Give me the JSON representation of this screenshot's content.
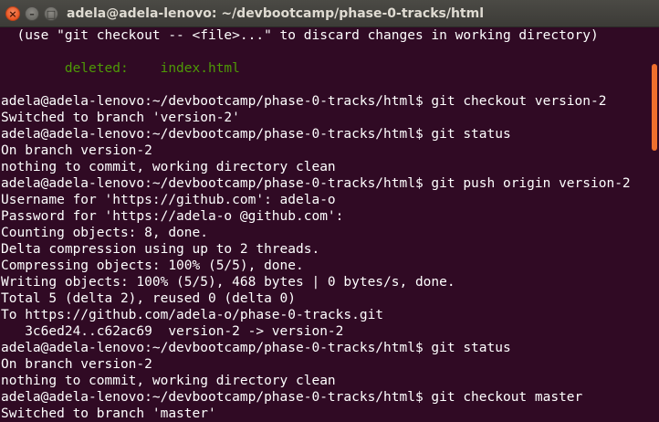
{
  "window": {
    "title": "adela@adela-lenovo: ~/devbootcamp/phase-0-tracks/html",
    "buttons": {
      "close": "×",
      "minimize": "–",
      "maximize": "□"
    }
  },
  "terminal": {
    "lines": [
      "  (use \"git checkout -- <file>...\" to discard changes in working directory)",
      "",
      "        deleted:    index.html",
      "",
      "adela@adela-lenovo:~/devbootcamp/phase-0-tracks/html$ git checkout version-2",
      "Switched to branch 'version-2'",
      "adela@adela-lenovo:~/devbootcamp/phase-0-tracks/html$ git status",
      "On branch version-2",
      "nothing to commit, working directory clean",
      "adela@adela-lenovo:~/devbootcamp/phase-0-tracks/html$ git push origin version-2",
      "Username for 'https://github.com': adela-o",
      "Password for 'https://adela-o @github.com':",
      "Counting objects: 8, done.",
      "Delta compression using up to 2 threads.",
      "Compressing objects: 100% (5/5), done.",
      "Writing objects: 100% (5/5), 468 bytes | 0 bytes/s, done.",
      "Total 5 (delta 2), reused 0 (delta 0)",
      "To https://github.com/adela-o/phase-0-tracks.git",
      "   3c6ed24..c62ac69  version-2 -> version-2",
      "adela@adela-lenovo:~/devbootcamp/phase-0-tracks/html$ git status",
      "On branch version-2",
      "nothing to commit, working directory clean",
      "adela@adela-lenovo:~/devbootcamp/phase-0-tracks/html$ git checkout master",
      "Switched to branch 'master'"
    ]
  },
  "colors": {
    "background": "#300a24",
    "text": "#ffffff",
    "deleted": "#4e9a06",
    "scrollbar_thumb": "#ef6f2e"
  }
}
